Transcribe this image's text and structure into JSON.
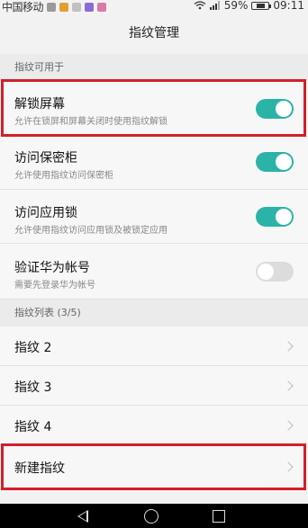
{
  "status_bar": {
    "carrier": "中国移动",
    "battery": "59%",
    "battery_level": 0.59,
    "time": "09:11",
    "colors": {
      "app1": "#9a9a9a",
      "app2": "#e0a030",
      "app3": "#c0c0c0",
      "app4": "#8b6ad6",
      "app5": "#d97aa8"
    }
  },
  "header": {
    "title": "指纹管理"
  },
  "section_usage": {
    "label": "指纹可用于"
  },
  "settings": [
    {
      "title": "解锁屏幕",
      "subtitle": "允许在锁屏和屏幕关闭时使用指纹解锁",
      "enabled": true
    },
    {
      "title": "访问保密柜",
      "subtitle": "允许使用指纹访问保密柜",
      "enabled": true
    },
    {
      "title": "访问应用锁",
      "subtitle": "允许使用指纹访问应用锁及被锁定应用",
      "enabled": true
    },
    {
      "title": "验证华为帐号",
      "subtitle": "需要先登录华为帐号",
      "enabled": false
    }
  ],
  "section_list": {
    "label": "指纹列表 (3/5)"
  },
  "fingerprints": [
    {
      "label": "指纹 2"
    },
    {
      "label": "指纹 3"
    },
    {
      "label": "指纹 4"
    }
  ],
  "new_fingerprint": {
    "label": "新建指纹"
  },
  "colors": {
    "toggle_on": "#2bb3a8",
    "toggle_off": "#dcdcdc",
    "highlight": "#d21f2a"
  }
}
